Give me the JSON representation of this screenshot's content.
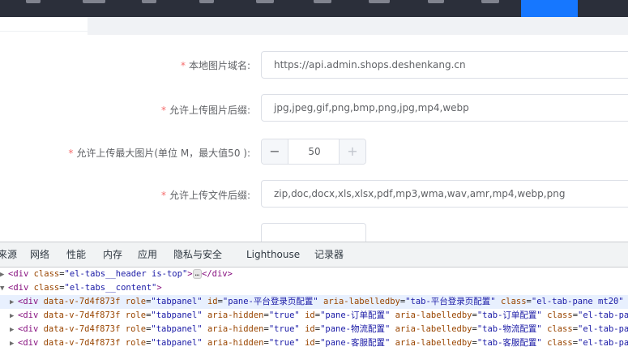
{
  "form": {
    "domain": {
      "label": "本地图片域名:",
      "value": "https://api.admin.shops.deshenkang.cn"
    },
    "image_ext": {
      "label": "允许上传图片后缀:",
      "value": "jpg,jpeg,gif,png,bmp,png,jpg,mp4,webp"
    },
    "max_image": {
      "label": "允许上传最大图片(单位 M，最大值50 ):",
      "value": "50"
    },
    "file_ext": {
      "label": "允许上传文件后缀:",
      "value": "zip,doc,docx,xls,xlsx,pdf,mp3,wma,wav,amr,mp4,webp,png"
    },
    "required_mark": "*"
  },
  "devtools": {
    "tabs": [
      "来源",
      "网络",
      "性能",
      "内存",
      "应用",
      "隐私与安全",
      "Lighthouse",
      "记录器"
    ],
    "lines": [
      {
        "open": "<div ",
        "attrs": [
          [
            "class",
            "\"el-tabs__header is-top\""
          ]
        ],
        "close": ">",
        "ellipsis": "…",
        "tail": "</div>"
      },
      {
        "open": "<div ",
        "attrs": [
          [
            "class",
            "\"el-tabs__content\""
          ]
        ],
        "close": ">"
      },
      {
        "open": "<div ",
        "attrs": [
          [
            "data-v-7d4f873f",
            ""
          ],
          [
            "role",
            "\"tabpanel\""
          ],
          [
            "id",
            "\"pane-平台登录页配置\""
          ],
          [
            "aria-labelledby",
            "\"tab-平台登录页配置\""
          ],
          [
            "class",
            "\"el-tab-pane mt20\""
          ],
          [
            "ar",
            ""
          ]
        ],
        "close": ""
      },
      {
        "open": "<div ",
        "attrs": [
          [
            "data-v-7d4f873f",
            ""
          ],
          [
            "role",
            "\"tabpanel\""
          ],
          [
            "aria-hidden",
            "\"true\""
          ],
          [
            "id",
            "\"pane-订单配置\""
          ],
          [
            "aria-labelledby",
            "\"tab-订单配置\""
          ],
          [
            "class",
            "\"el-tab-pane m"
          ]
        ],
        "close": ""
      },
      {
        "open": "<div ",
        "attrs": [
          [
            "data-v-7d4f873f",
            ""
          ],
          [
            "role",
            "\"tabpanel\""
          ],
          [
            "aria-hidden",
            "\"true\""
          ],
          [
            "id",
            "\"pane-物流配置\""
          ],
          [
            "aria-labelledby",
            "\"tab-物流配置\""
          ],
          [
            "class",
            "\"el-tab-pane m"
          ]
        ],
        "close": ""
      },
      {
        "open": "<div ",
        "attrs": [
          [
            "data-v-7d4f873f",
            ""
          ],
          [
            "role",
            "\"tabpanel\""
          ],
          [
            "aria-hidden",
            "\"true\""
          ],
          [
            "id",
            "\"pane-客服配置\""
          ],
          [
            "aria-labelledby",
            "\"tab-客服配置\""
          ],
          [
            "class",
            "\"el-tab-pane m"
          ]
        ],
        "close": ""
      }
    ]
  }
}
